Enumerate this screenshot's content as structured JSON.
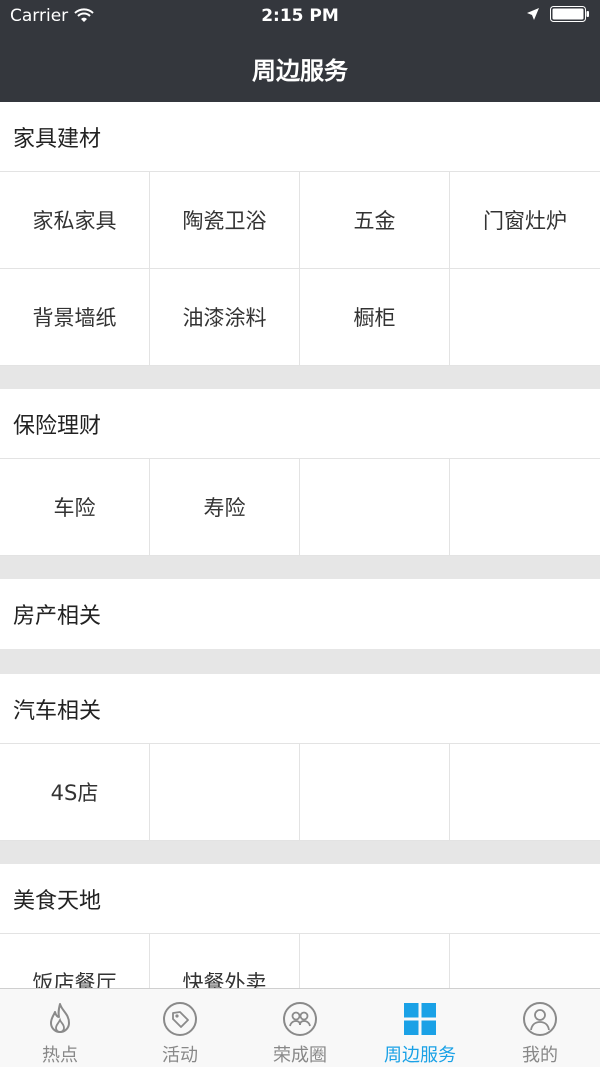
{
  "status_bar": {
    "carrier": "Carrier",
    "time": "2:15 PM"
  },
  "nav": {
    "title": "周边服务"
  },
  "sections": [
    {
      "title": "家具建材",
      "items": [
        "家私家具",
        "陶瓷卫浴",
        "五金",
        "门窗灶炉",
        "背景墙纸",
        "油漆涂料",
        "橱柜",
        ""
      ]
    },
    {
      "title": "保险理财",
      "items": [
        "车险",
        "寿险",
        "",
        ""
      ]
    },
    {
      "title": "房产相关",
      "items": []
    },
    {
      "title": "汽车相关",
      "items": [
        "4S店",
        "",
        "",
        ""
      ]
    },
    {
      "title": "美食天地",
      "items": [
        "饭店餐厅",
        "快餐外卖",
        "",
        ""
      ]
    }
  ],
  "tabs": [
    {
      "label": "热点",
      "icon": "flame-icon",
      "active": false
    },
    {
      "label": "活动",
      "icon": "tag-icon",
      "active": false
    },
    {
      "label": "荣成圈",
      "icon": "group-icon",
      "active": false
    },
    {
      "label": "周边服务",
      "icon": "grid-icon",
      "active": true
    },
    {
      "label": "我的",
      "icon": "user-icon",
      "active": false
    }
  ],
  "colors": {
    "header_bg": "#34373d",
    "accent": "#1aa1e6",
    "tab_inactive": "#888888",
    "section_gap": "#e6e6e6"
  }
}
